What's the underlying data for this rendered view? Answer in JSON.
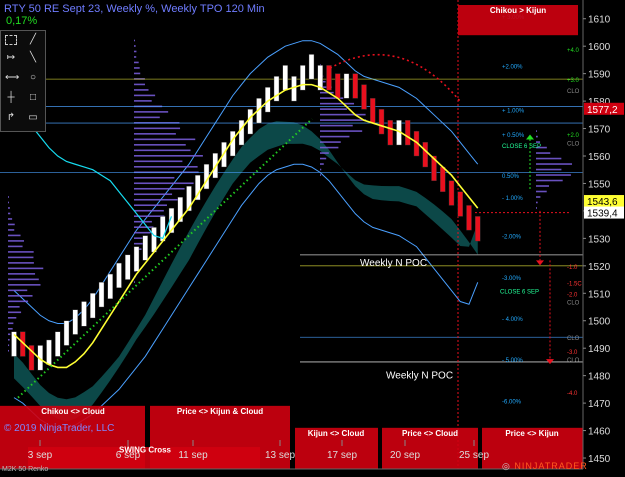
{
  "header": {
    "title": "RTY 50 RE Sept 23, Weekly %, Weekly TPO 120 Min",
    "change": "0,17%"
  },
  "footer": {
    "copyright": "© 2019 NinjaTrader, LLC",
    "series_type": "M2K 50 Renko",
    "logo_a": "NINJA",
    "logo_b": "TRADER"
  },
  "colors": {
    "up": "#ffffff",
    "down": "#e8101e",
    "tenkan": "#ffff33",
    "kijun": "#16dcf0",
    "chikou": "#22cc22",
    "cloud": "#1aa0a0",
    "profile": "#7b5fe0",
    "signal": "#d00010"
  },
  "chart_data": {
    "type": "candlestick",
    "title": "RTY 50 RE Sept 23, Weekly %, Weekly TPO 120 Min",
    "x_labels": [
      "3 sep",
      "6 sep",
      "11 sep",
      "13 sep",
      "17 sep",
      "20 sep",
      "25 sep"
    ],
    "y_ticks": [
      1450,
      1460,
      1470,
      1480,
      1490,
      1500,
      1510,
      1520,
      1530,
      1540,
      1550,
      1560,
      1570,
      1580,
      1590,
      1600,
      1610
    ],
    "ylim": [
      1446,
      1615
    ],
    "price_tags": [
      {
        "value": 1577.2,
        "label": "1577,2",
        "color": "#d00010",
        "text": "#ffffff"
      },
      {
        "value": 1543.6,
        "label": "1543,6",
        "color": "#ffff33",
        "text": "#000000"
      },
      {
        "value": 1539.4,
        "label": "1539,4",
        "color": "#ffffff",
        "text": "#000000"
      }
    ],
    "percent_levels": [
      {
        "label": "+ 3.00%",
        "value": 1611
      },
      {
        "label": "+2.00%",
        "value": 1593
      },
      {
        "label": "+ 1.00%",
        "value": 1577
      },
      {
        "label": "+ 0.50%",
        "value": 1568
      },
      {
        "label": "0.50%",
        "value": 1553
      },
      {
        "label": "- 1.00%",
        "value": 1545
      },
      {
        "label": "-2.00%",
        "value": 1531
      },
      {
        "label": "-3.00%",
        "value": 1516
      },
      {
        "label": "- 4.00%",
        "value": 1501
      },
      {
        "label": "- 5.00%",
        "value": 1486
      },
      {
        "label": "-6.00%",
        "value": 1471
      }
    ],
    "right_edge_levels": [
      {
        "label": "+4.0",
        "value": 1599
      },
      {
        "label": "+3.0",
        "value": 1588
      },
      {
        "label": "CLO",
        "value": 1584
      },
      {
        "label": "+2.0",
        "value": 1568
      },
      {
        "label": "CLO",
        "value": 1565
      },
      {
        "label": "-1.0",
        "value": 1520
      },
      {
        "label": "-1.5C",
        "value": 1514
      },
      {
        "label": "-2.0",
        "value": 1510
      },
      {
        "label": "CLO",
        "value": 1507
      },
      {
        "label": "CLO",
        "value": 1494
      },
      {
        "label": "-3.0",
        "value": 1489
      },
      {
        "label": "CLO",
        "value": 1486
      },
      {
        "label": "-4.0",
        "value": 1474
      }
    ],
    "annotations": [
      {
        "text": "Weekly N POC",
        "value": 1524
      },
      {
        "text": "Weekly N POC",
        "value": 1483
      },
      {
        "text": "CLOSE 6 SEP",
        "value": 1510
      },
      {
        "text": "CLOSE 6 SEP",
        "value": 1563
      }
    ],
    "signal_boxes": [
      "Chikou > Kijun",
      "Chikou <> Cloud",
      "Price <> Kijun & Cloud",
      "SWING Cross",
      "Kijun <> Cloud",
      "Price <> Cloud",
      "Price <> Kijun"
    ],
    "candles": [
      [
        "u",
        1487,
        1496
      ],
      [
        "d",
        1496,
        1487
      ],
      [
        "d",
        1491,
        1482
      ],
      [
        "u",
        1482,
        1491
      ],
      [
        "u",
        1484,
        1493
      ],
      [
        "u",
        1487,
        1496
      ],
      [
        "u",
        1491,
        1500
      ],
      [
        "u",
        1495,
        1504
      ],
      [
        "u",
        1498,
        1507
      ],
      [
        "u",
        1501,
        1510
      ],
      [
        "u",
        1505,
        1514
      ],
      [
        "u",
        1508,
        1517
      ],
      [
        "u",
        1512,
        1521
      ],
      [
        "u",
        1515,
        1524
      ],
      [
        "u",
        1518,
        1527
      ],
      [
        "u",
        1522,
        1531
      ],
      [
        "u",
        1525,
        1534
      ],
      [
        "u",
        1529,
        1538
      ],
      [
        "u",
        1532,
        1541
      ],
      [
        "u",
        1536,
        1545
      ],
      [
        "u",
        1540,
        1549
      ],
      [
        "u",
        1544,
        1553
      ],
      [
        "u",
        1548,
        1557
      ],
      [
        "u",
        1552,
        1561
      ],
      [
        "u",
        1556,
        1565
      ],
      [
        "u",
        1560,
        1569
      ],
      [
        "u",
        1564,
        1573
      ],
      [
        "u",
        1568,
        1577
      ],
      [
        "u",
        1572,
        1581
      ],
      [
        "u",
        1576,
        1585
      ],
      [
        "u",
        1580,
        1589
      ],
      [
        "u",
        1584,
        1593
      ],
      [
        "u",
        1580,
        1589
      ],
      [
        "u",
        1584,
        1593
      ],
      [
        "u",
        1588,
        1597
      ],
      [
        "u",
        1584,
        1593
      ],
      [
        "d",
        1593,
        1584
      ],
      [
        "d",
        1590,
        1581
      ],
      [
        "u",
        1581,
        1590
      ],
      [
        "d",
        1590,
        1581
      ],
      [
        "d",
        1586,
        1577
      ],
      [
        "d",
        1581,
        1572
      ],
      [
        "d",
        1577,
        1568
      ],
      [
        "d",
        1573,
        1564
      ],
      [
        "u",
        1564,
        1573
      ],
      [
        "d",
        1573,
        1564
      ],
      [
        "d",
        1569,
        1560
      ],
      [
        "d",
        1565,
        1556
      ],
      [
        "d",
        1560,
        1551
      ],
      [
        "d",
        1556,
        1547
      ],
      [
        "d",
        1551,
        1542
      ],
      [
        "d",
        1547,
        1538
      ],
      [
        "d",
        1542,
        1533
      ],
      [
        "d",
        1538,
        1529
      ]
    ],
    "tenkan": [
      1495,
      1492,
      1489,
      1486,
      1484,
      1483,
      1483,
      1485,
      1488,
      1492,
      1497,
      1502,
      1507,
      1512,
      1517,
      1521,
      1525,
      1529,
      1533,
      1537,
      1541,
      1546,
      1551,
      1556,
      1561,
      1566,
      1570,
      1574,
      1577,
      1580,
      1582,
      1584,
      1585,
      1586,
      1586,
      1585,
      1583,
      1581,
      1578,
      1575,
      1573,
      1572,
      1571,
      1570,
      1569,
      1567,
      1565,
      1562,
      1559,
      1556,
      1553,
      1549,
      1545,
      1541
    ],
    "kijun": [
      1496,
      1494,
      1491,
      1488,
      1486,
      1485,
      1485,
      1486,
      1488,
      1490,
      1493,
      1496,
      1499,
      1503,
      1507,
      1511,
      1516,
      1521,
      1526,
      1531,
      1536,
      1541,
      1546,
      1551,
      1556,
      1561,
      1566,
      1570,
      1574,
      1577,
      1579,
      1580,
      1581,
      1581,
      1580,
      1578,
      1575,
      1571,
      1567,
      1563,
      1560,
      1558,
      1557,
      1556,
      1555,
      1553,
      1551,
      1547,
      1543,
      1539,
      1535,
      1531,
      1530,
      1538
    ]
  }
}
